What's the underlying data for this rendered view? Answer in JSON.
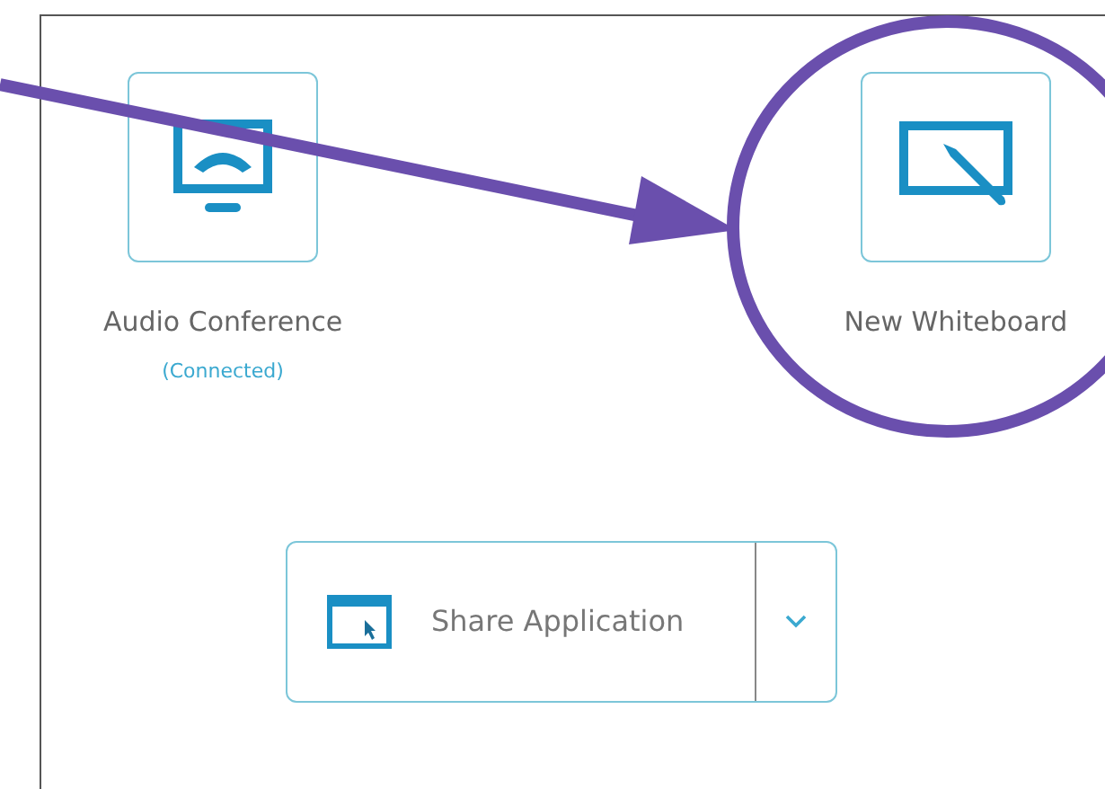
{
  "tiles": [
    {
      "kind": "audio",
      "label": "Audio Conference",
      "status": "(Connected)"
    },
    {
      "kind": "whiteboard",
      "label": "New Whiteboard"
    }
  ],
  "share_button": {
    "label": "Share Application",
    "kind": "dropdown"
  }
}
